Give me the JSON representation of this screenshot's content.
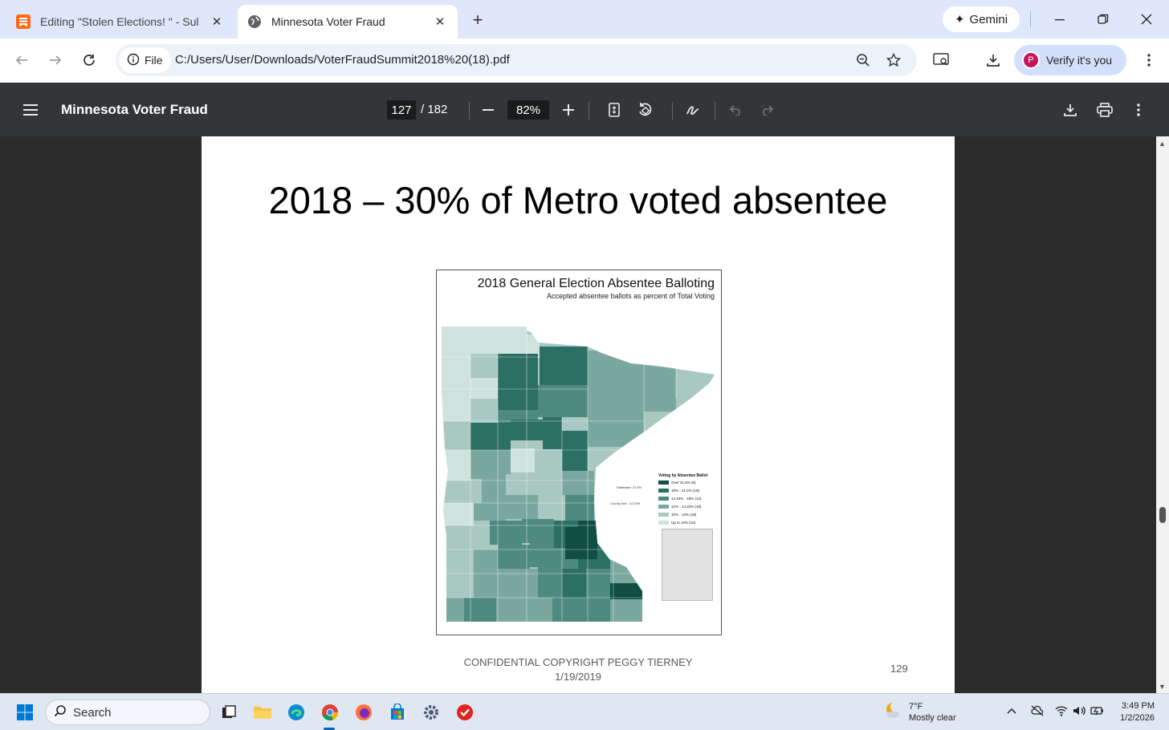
{
  "browser": {
    "tabs": [
      {
        "title": "Editing \"Stolen Elections! \" - Sul",
        "active": false
      },
      {
        "title": "Minnesota Voter Fraud",
        "active": true
      }
    ],
    "gemini_label": "Gemini",
    "chip_label": "File",
    "url": "C:/Users/User/Downloads/VoterFraudSummit2018%20(18).pdf",
    "verify_label": "Verify it's you",
    "avatar_letter": "P"
  },
  "pdf": {
    "title": "Minnesota Voter Fraud",
    "current_page": "127",
    "total_pages": "/ 182",
    "zoom": "82%"
  },
  "slide": {
    "title": "2018 – 30% of Metro voted absentee",
    "footer_line1": "CONFIDENTIAL COPYRIGHT PEGGY TIERNEY",
    "footer_line2": "1/19/2019",
    "page_number": "129"
  },
  "figure": {
    "title": "2018 General Election Absentee Balloting",
    "subtitle": "Accepted absentee ballots as percent of Total Voting",
    "legend_title": "Voting by Absentee Ballot",
    "legend": [
      {
        "label": "Over 21.5% (6)",
        "color": "#0f4d45"
      },
      {
        "label": "18% - 21.5% (19)",
        "color": "#2b6f65"
      },
      {
        "label": "14.23% - 18% (13)",
        "color": "#4f8a80"
      },
      {
        "label": "12% - 14.23% (18)",
        "color": "#7aa89f"
      },
      {
        "label": "10% - 12% (19)",
        "color": "#a8c8c1"
      },
      {
        "label": "Up to 10% (12)",
        "color": "#cfe3de"
      }
    ],
    "statewide_note": "Statewide: 21.5%",
    "county_note": "County Ave.: 14.23%"
  },
  "taskbar": {
    "search_label": "Search",
    "weather_temp": "7°F",
    "weather_desc": "Mostly clear",
    "time": "3:49 PM",
    "date": "1/2/2026"
  }
}
